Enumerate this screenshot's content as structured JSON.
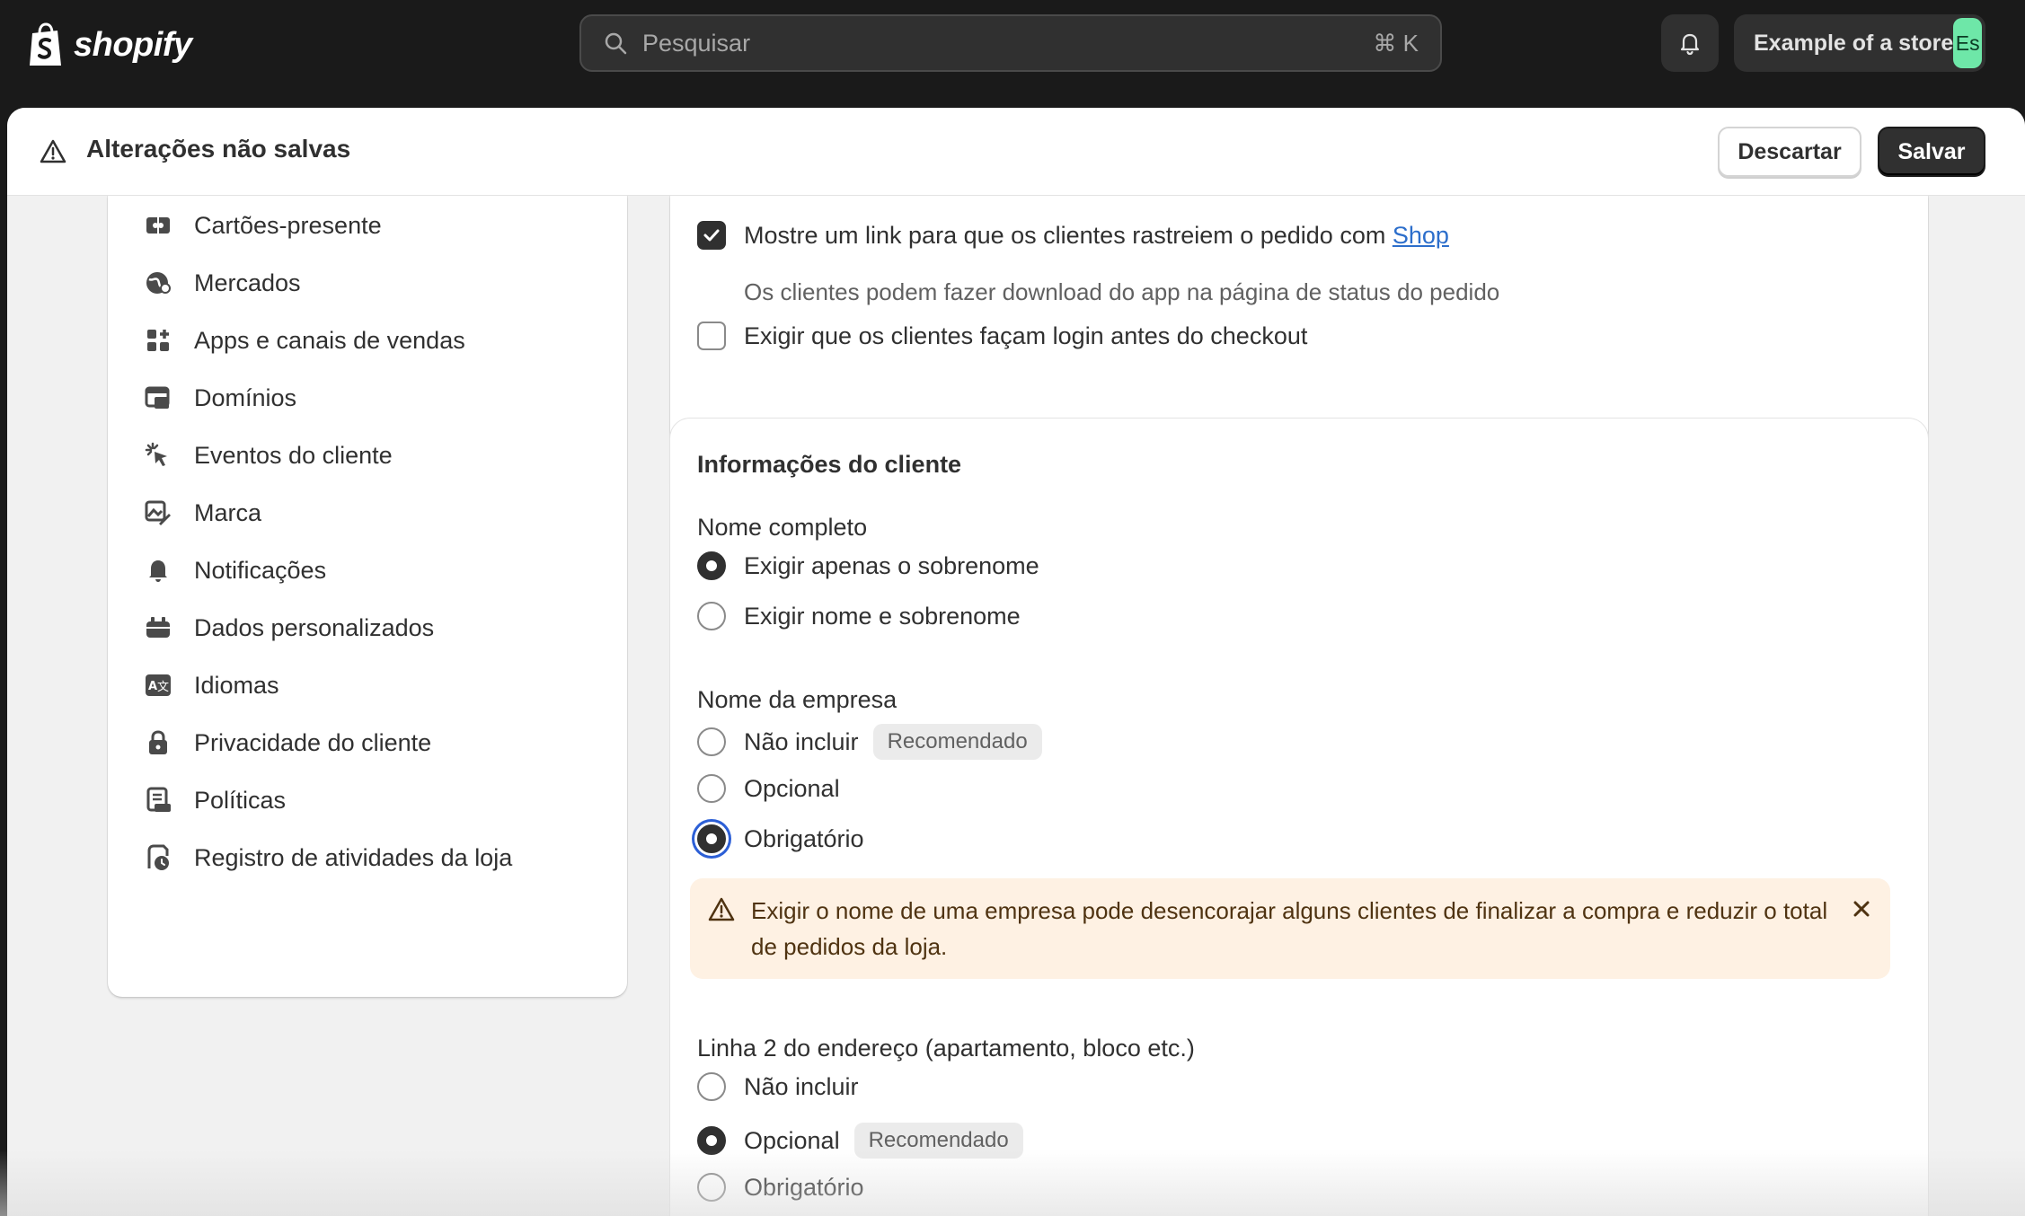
{
  "topbar": {
    "brand": "shopify",
    "search_placeholder": "Pesquisar",
    "search_shortcut": "⌘ K",
    "store_name": "Example of a store",
    "store_avatar": "Es",
    "avatar_color": "#6ee7a8"
  },
  "unsaved": {
    "title": "Alterações não salvas",
    "discard_label": "Descartar",
    "save_label": "Salvar"
  },
  "sidebar": {
    "items": [
      {
        "label": "Cartões-presente",
        "icon": "gift-card-icon"
      },
      {
        "label": "Mercados",
        "icon": "globe-icon"
      },
      {
        "label": "Apps e canais de vendas",
        "icon": "apps-icon"
      },
      {
        "label": "Domínios",
        "icon": "domains-icon"
      },
      {
        "label": "Eventos do cliente",
        "icon": "cursor-click-icon"
      },
      {
        "label": "Marca",
        "icon": "brand-icon"
      },
      {
        "label": "Notificações",
        "icon": "bell-icon"
      },
      {
        "label": "Dados personalizados",
        "icon": "custom-data-icon"
      },
      {
        "label": "Idiomas",
        "icon": "language-icon"
      },
      {
        "label": "Privacidade do cliente",
        "icon": "lock-icon"
      },
      {
        "label": "Políticas",
        "icon": "policies-icon"
      },
      {
        "label": "Registro de atividades da loja",
        "icon": "activity-log-icon"
      }
    ]
  },
  "checkout_options": {
    "shop_link": {
      "label": "Mostre um link para que os clientes rastreiem o pedido com",
      "link_text": "Shop",
      "help": "Os clientes podem fazer download do app na página de status do pedido",
      "checked": true
    },
    "require_login": {
      "label": "Exigir que os clientes façam login antes do checkout",
      "checked": false
    }
  },
  "customer_info": {
    "title": "Informações do cliente",
    "full_name": {
      "label": "Nome completo",
      "options": [
        {
          "label": "Exigir apenas o sobrenome",
          "selected": true
        },
        {
          "label": "Exigir nome e sobrenome",
          "selected": false
        }
      ]
    },
    "company_name": {
      "label": "Nome da empresa",
      "options": [
        {
          "label": "Não incluir",
          "badge": "Recomendado",
          "selected": false
        },
        {
          "label": "Opcional",
          "selected": false
        },
        {
          "label": "Obrigatório",
          "selected": true
        }
      ],
      "warning": "Exigir o nome de uma empresa pode desencorajar alguns clientes de finalizar a compra e reduzir o total de pedidos da loja."
    },
    "address_line2": {
      "label": "Linha 2 do endereço (apartamento, bloco etc.)",
      "options": [
        {
          "label": "Não incluir",
          "selected": false
        },
        {
          "label": "Opcional",
          "badge": "Recomendado",
          "selected": true
        },
        {
          "label": "Obrigatório",
          "selected": false
        }
      ]
    }
  },
  "colors": {
    "topbar_bg": "#1a1a1a",
    "panel_bg": "#f1f1f1",
    "link": "#2c6ecb",
    "warning_bg": "#fef1e3",
    "focus_ring": "#2c5fd6"
  }
}
